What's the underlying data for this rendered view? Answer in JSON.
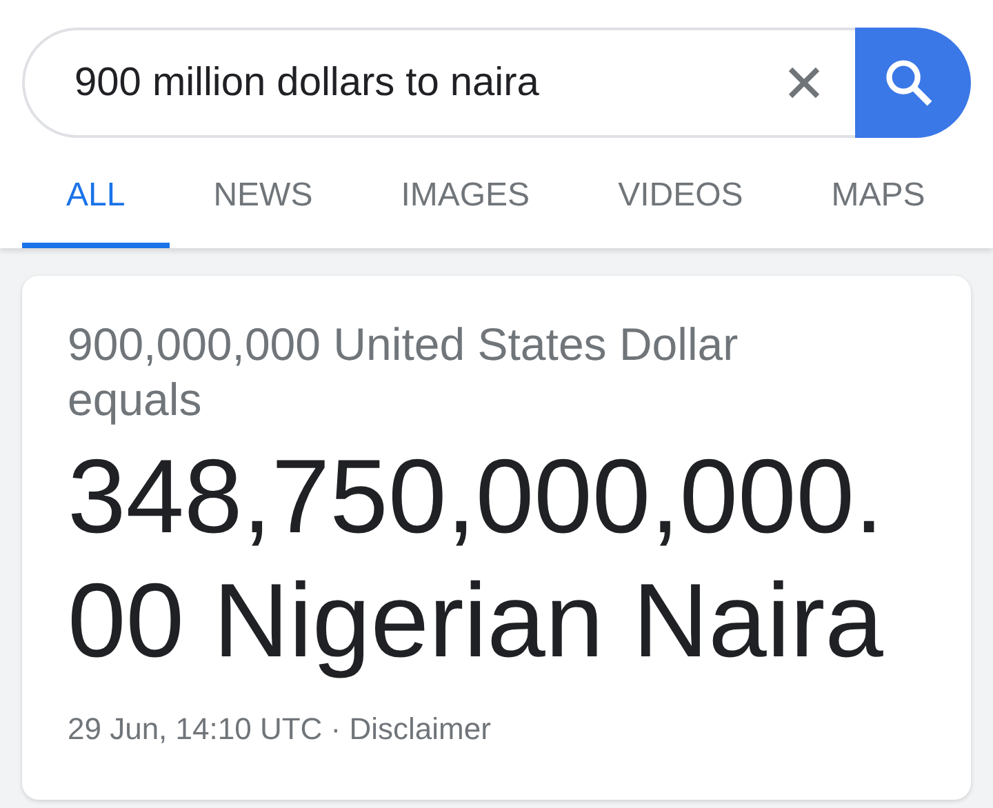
{
  "search": {
    "value": "900 million dollars to naira"
  },
  "tabs": [
    {
      "label": "ALL",
      "selected": true
    },
    {
      "label": "NEWS",
      "selected": false
    },
    {
      "label": "IMAGES",
      "selected": false
    },
    {
      "label": "VIDEOS",
      "selected": false
    },
    {
      "label": "MAPS",
      "selected": false
    }
  ],
  "result": {
    "source": "900,000,000 United States Dollar equals",
    "converted": "348,750,000,000.00 Nigerian Naira",
    "timestamp": "29 Jun, 14:10 UTC",
    "separator": "·",
    "disclaimer": "Disclaimer"
  }
}
